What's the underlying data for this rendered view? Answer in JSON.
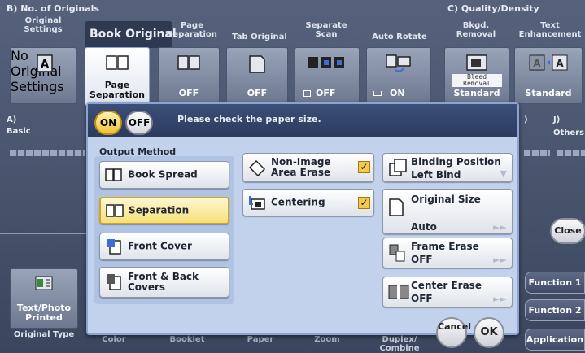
{
  "top_sections": {
    "b_label": "B)  No. of Originals",
    "c_label": "C)  Quality/Density"
  },
  "top_tabs": [
    {
      "label": "Original Settings"
    },
    {
      "label": "Book Original"
    },
    {
      "label": "Page Separation"
    },
    {
      "label": "Tab Original"
    },
    {
      "label": "Separate Scan"
    },
    {
      "label": "Auto Rotate"
    },
    {
      "label": "Bkgd. Removal"
    },
    {
      "label": "Text Enhancement"
    }
  ],
  "tiles": [
    {
      "label": "No Original Settings",
      "icon": "a-document-icon"
    },
    {
      "label": "Page Separation",
      "icon": "open-book-icon"
    },
    {
      "label": "OFF",
      "icon": "book-icon"
    },
    {
      "label": "OFF",
      "icon": "tab-page-icon"
    },
    {
      "label": "OFF",
      "icon": "separate-scan-icon"
    },
    {
      "label": "ON",
      "icon": "auto-rotate-icon"
    },
    {
      "label": "Standard",
      "icon": "bleed-removal-icon",
      "badge": "Bleed Removal"
    },
    {
      "label": "Standard",
      "icon": "text-enhance-icon"
    }
  ],
  "left_labels": {
    "a": "A)",
    "basic": "Basic",
    "i": ")",
    "j": "J)",
    "others": "Others"
  },
  "original_type": {
    "label": "Text/Photo Printed",
    "caption": "Original Type"
  },
  "bottom_captions": [
    "Color",
    "Booklet",
    "Paper",
    "Zoom",
    "Duplex/ Combine"
  ],
  "right_tabs": {
    "close": "Close",
    "function1": "Function 1",
    "function2": "Function 2",
    "application": "Application"
  },
  "dialog": {
    "on": "ON",
    "off": "OFF",
    "message": "Please check the paper size.",
    "output_method_label": "Output Method",
    "output_methods": [
      {
        "label": "Book Spread"
      },
      {
        "label": "Separation"
      },
      {
        "label": "Front Cover"
      },
      {
        "label": "Front & Back Covers"
      }
    ],
    "non_image": "Non-Image Area Erase",
    "centering": "Centering",
    "binding_label": "Binding Position",
    "binding_value": "Left Bind",
    "original_size_label": "Original Size",
    "original_size_value": "Auto",
    "frame_erase_label": "Frame Erase",
    "frame_erase_value": "OFF",
    "center_erase_label": "Center Erase",
    "center_erase_value": "OFF",
    "cancel": "Cancel",
    "ok": "OK"
  }
}
